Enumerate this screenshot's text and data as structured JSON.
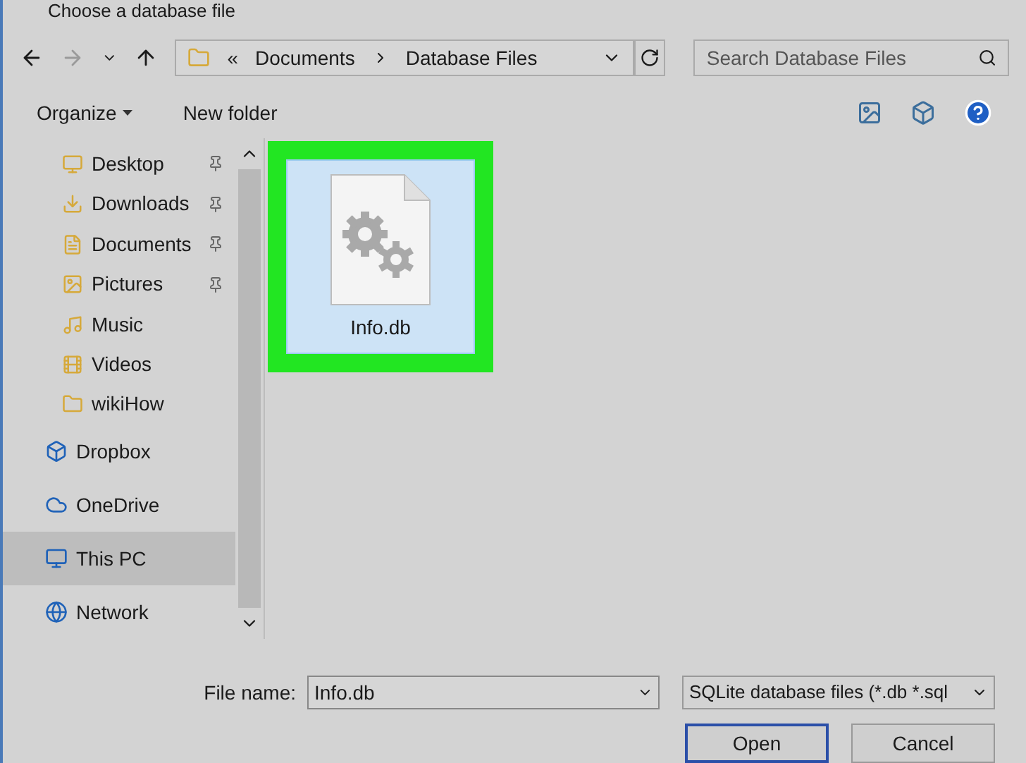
{
  "window": {
    "title": "Choose a database file"
  },
  "address": {
    "breadcrumbs": [
      "«",
      "Documents",
      "Database Files"
    ]
  },
  "search": {
    "placeholder": "Search Database Files"
  },
  "toolbar": {
    "organize": "Organize",
    "new_folder": "New folder"
  },
  "sidebar": {
    "items": [
      {
        "label": "Desktop",
        "kind": "quick",
        "pinned": true,
        "selected": false
      },
      {
        "label": "Downloads",
        "kind": "quick",
        "pinned": true,
        "selected": false
      },
      {
        "label": "Documents",
        "kind": "quick",
        "pinned": true,
        "selected": false
      },
      {
        "label": "Pictures",
        "kind": "quick",
        "pinned": true,
        "selected": false
      },
      {
        "label": "Music",
        "kind": "quick",
        "pinned": false,
        "selected": false
      },
      {
        "label": "Videos",
        "kind": "quick",
        "pinned": false,
        "selected": false
      },
      {
        "label": "wikiHow",
        "kind": "quick",
        "pinned": false,
        "selected": false
      },
      {
        "label": "Dropbox",
        "kind": "root",
        "pinned": false,
        "selected": false
      },
      {
        "label": "OneDrive",
        "kind": "root",
        "pinned": false,
        "selected": false
      },
      {
        "label": "This PC",
        "kind": "root",
        "pinned": false,
        "selected": true
      },
      {
        "label": "Network",
        "kind": "root",
        "pinned": false,
        "selected": false
      }
    ]
  },
  "files": [
    {
      "name": "Info.db",
      "selected": true,
      "highlighted": true
    }
  ],
  "footer": {
    "file_name_label": "File name:",
    "file_name": "Info.db",
    "file_type": "SQLite database files (*.db *.sql",
    "open": "Open",
    "cancel": "Cancel"
  }
}
